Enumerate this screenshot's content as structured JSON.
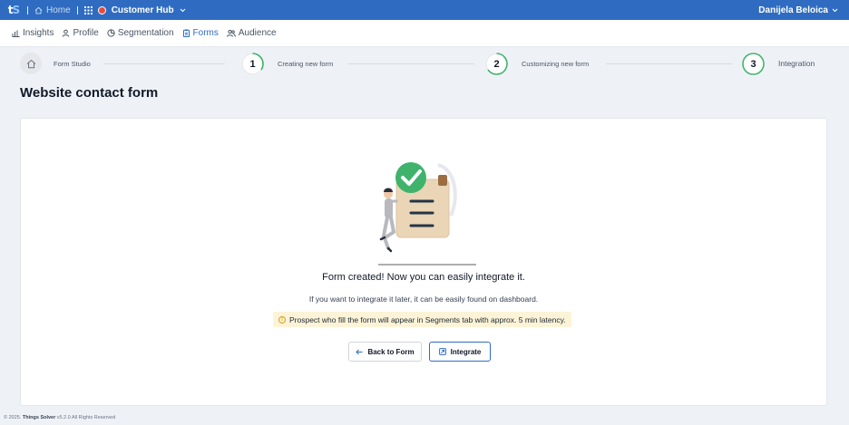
{
  "topbar": {
    "logo_t": "t",
    "logo_s": "S",
    "home_label": "Home",
    "app_name": "Customer Hub",
    "user_name": "Danijela Beloica",
    "colors": {
      "bar": "#2f6cc1"
    }
  },
  "nav": {
    "items": [
      {
        "label": "Insights",
        "icon": "bar-chart-icon"
      },
      {
        "label": "Profile",
        "icon": "user-icon"
      },
      {
        "label": "Segmentation",
        "icon": "pie-chart-icon"
      },
      {
        "label": "Forms",
        "icon": "clipboard-icon",
        "active": true
      },
      {
        "label": "Audience",
        "icon": "users-icon"
      }
    ]
  },
  "stepper": {
    "home_label": "Form Studio",
    "steps": [
      {
        "number": "1",
        "label": "Creating new form"
      },
      {
        "number": "2",
        "label": "Customizing new form"
      },
      {
        "number": "3",
        "label": "Integration"
      }
    ]
  },
  "page": {
    "title": "Website contact form"
  },
  "result": {
    "title": "Form created! Now you can easily integrate it.",
    "subtitle": "If you want to integrate it later, it can be easily found on dashboard.",
    "notice": "Prospect who fill the form will appear in Segments tab with approx. 5 min latency.",
    "back_label": "Back to Form",
    "integrate_label": "Integrate"
  },
  "footer": {
    "prefix": "© 2025.",
    "company": "Things Solver",
    "suffix": "v5.2.0 All Rights Reserved"
  }
}
